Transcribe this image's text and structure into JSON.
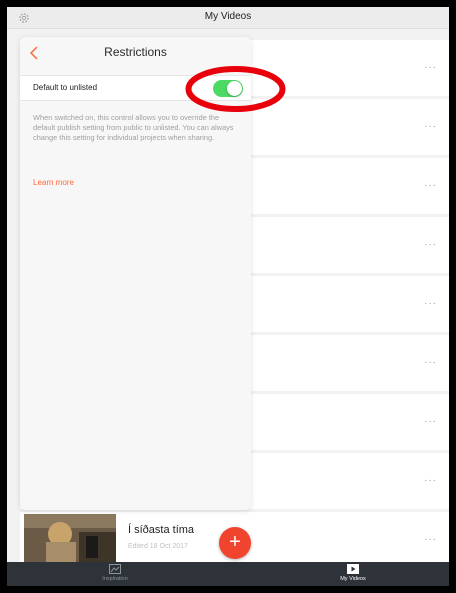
{
  "header": {
    "title": "My Videos",
    "settings_icon": "gear-icon"
  },
  "panel": {
    "back_icon": "chevron-left-icon",
    "title": "Restrictions",
    "toggle_label": "Default to unlisted",
    "toggle_on": true,
    "description": "When switched on, this control allows you to override the default publish setting from public to unlisted. You can always change this setting for individual projects when sharing.",
    "learn_more": "Learn more"
  },
  "videos": {
    "more_label": "···",
    "last": {
      "name": "Í síðasta tíma",
      "date": "Edited 18 Oct 2017"
    }
  },
  "tabbar": {
    "inspiration": "Inspiration",
    "my_videos": "My Videos",
    "add_label": "+"
  },
  "colors": {
    "accent": "#f0442f",
    "toggle_on": "#4cd964",
    "link": "#ff6a3d",
    "annotation": "#e8000b",
    "tabbar_bg": "#2d3338"
  }
}
